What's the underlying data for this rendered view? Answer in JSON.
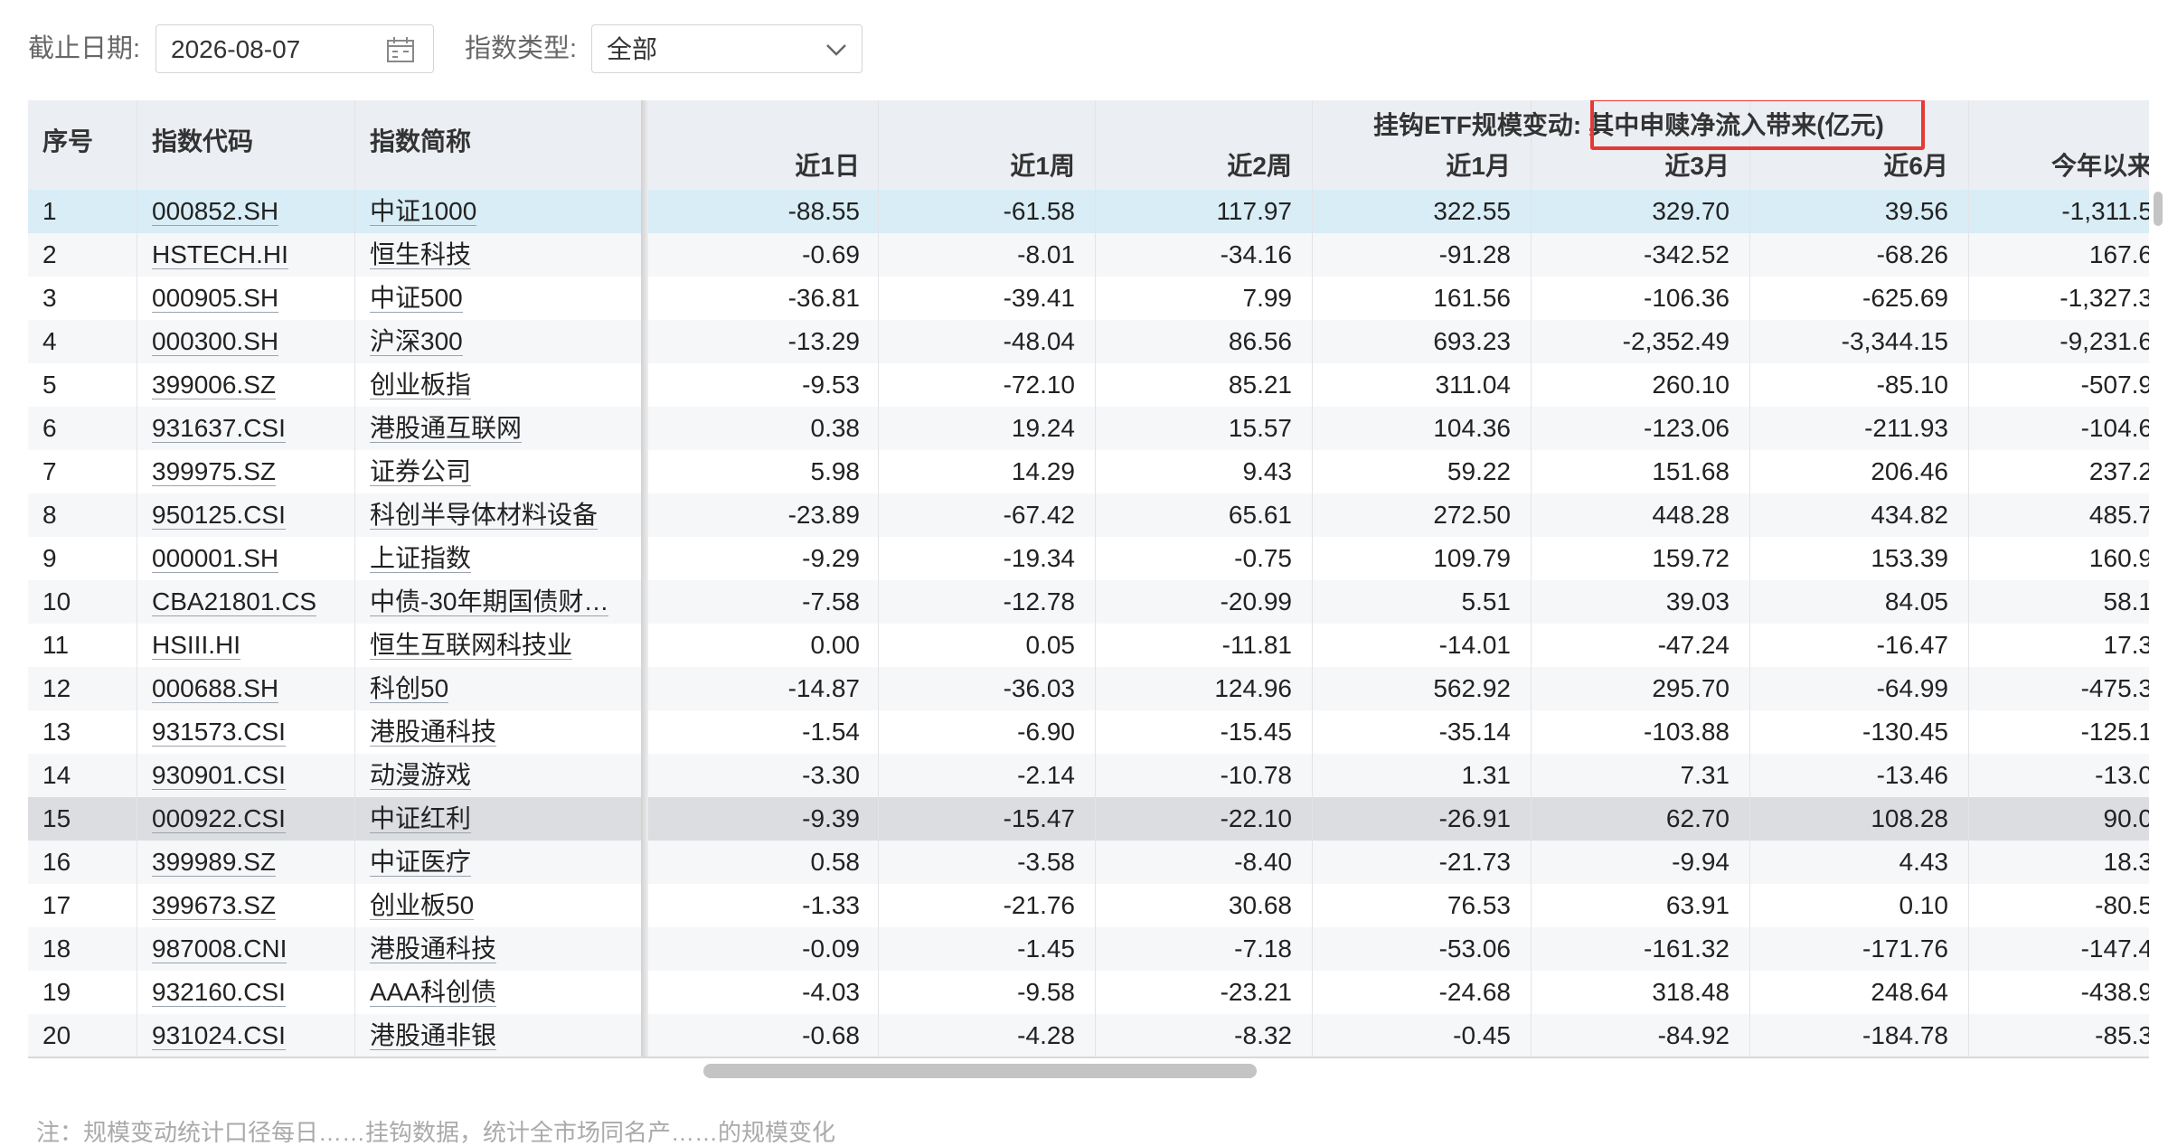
{
  "filters": {
    "date_label": "截止日期:",
    "date_value": "2026-08-07",
    "type_label": "指数类型:",
    "type_value": "全部"
  },
  "table": {
    "group_title": "挂钩ETF规模变动:",
    "group_subtitle": "其中申赎净流入带来(亿元)",
    "fixed_headers": [
      "序号",
      "指数代码",
      "指数简称"
    ],
    "period_headers": [
      "近1日",
      "近1周",
      "近2周",
      "近1月",
      "近3月",
      "近6月",
      "今年以来"
    ],
    "rows": [
      {
        "no": "1",
        "code": "000852.SH",
        "name": "中证1000",
        "v": [
          "-88.55",
          "-61.58",
          "117.97",
          "322.55",
          "329.70",
          "39.56",
          "-1,311.5"
        ]
      },
      {
        "no": "2",
        "code": "HSTECH.HI",
        "name": "恒生科技",
        "v": [
          "-0.69",
          "-8.01",
          "-34.16",
          "-91.28",
          "-342.52",
          "-68.26",
          "167.6"
        ]
      },
      {
        "no": "3",
        "code": "000905.SH",
        "name": "中证500",
        "v": [
          "-36.81",
          "-39.41",
          "7.99",
          "161.56",
          "-106.36",
          "-625.69",
          "-1,327.3"
        ]
      },
      {
        "no": "4",
        "code": "000300.SH",
        "name": "沪深300",
        "v": [
          "-13.29",
          "-48.04",
          "86.56",
          "693.23",
          "-2,352.49",
          "-3,344.15",
          "-9,231.6"
        ]
      },
      {
        "no": "5",
        "code": "399006.SZ",
        "name": "创业板指",
        "v": [
          "-9.53",
          "-72.10",
          "85.21",
          "311.04",
          "260.10",
          "-85.10",
          "-507.9"
        ]
      },
      {
        "no": "6",
        "code": "931637.CSI",
        "name": "港股通互联网",
        "v": [
          "0.38",
          "19.24",
          "15.57",
          "104.36",
          "-123.06",
          "-211.93",
          "-104.6"
        ]
      },
      {
        "no": "7",
        "code": "399975.SZ",
        "name": "证券公司",
        "v": [
          "5.98",
          "14.29",
          "9.43",
          "59.22",
          "151.68",
          "206.46",
          "237.2"
        ]
      },
      {
        "no": "8",
        "code": "950125.CSI",
        "name": "科创半导体材料设备",
        "v": [
          "-23.89",
          "-67.42",
          "65.61",
          "272.50",
          "448.28",
          "434.82",
          "485.7"
        ]
      },
      {
        "no": "9",
        "code": "000001.SH",
        "name": "上证指数",
        "v": [
          "-9.29",
          "-19.34",
          "-0.75",
          "109.79",
          "159.72",
          "153.39",
          "160.9"
        ]
      },
      {
        "no": "10",
        "code": "CBA21801.CS",
        "name": "中债-30年期国债财…",
        "v": [
          "-7.58",
          "-12.78",
          "-20.99",
          "5.51",
          "39.03",
          "84.05",
          "58.1"
        ]
      },
      {
        "no": "11",
        "code": "HSIII.HI",
        "name": "恒生互联网科技业",
        "v": [
          "0.00",
          "0.05",
          "-11.81",
          "-14.01",
          "-47.24",
          "-16.47",
          "17.3"
        ]
      },
      {
        "no": "12",
        "code": "000688.SH",
        "name": "科创50",
        "v": [
          "-14.87",
          "-36.03",
          "124.96",
          "562.92",
          "295.70",
          "-64.99",
          "-475.3"
        ]
      },
      {
        "no": "13",
        "code": "931573.CSI",
        "name": "港股通科技",
        "v": [
          "-1.54",
          "-6.90",
          "-15.45",
          "-35.14",
          "-103.88",
          "-130.45",
          "-125.1"
        ]
      },
      {
        "no": "14",
        "code": "930901.CSI",
        "name": "动漫游戏",
        "v": [
          "-3.30",
          "-2.14",
          "-10.78",
          "1.31",
          "7.31",
          "-13.46",
          "-13.0"
        ]
      },
      {
        "no": "15",
        "code": "000922.CSI",
        "name": "中证红利",
        "v": [
          "-9.39",
          "-15.47",
          "-22.10",
          "-26.91",
          "62.70",
          "108.28",
          "90.0"
        ]
      },
      {
        "no": "16",
        "code": "399989.SZ",
        "name": "中证医疗",
        "v": [
          "0.58",
          "-3.58",
          "-8.40",
          "-21.73",
          "-9.94",
          "4.43",
          "18.3"
        ]
      },
      {
        "no": "17",
        "code": "399673.SZ",
        "name": "创业板50",
        "v": [
          "-1.33",
          "-21.76",
          "30.68",
          "76.53",
          "63.91",
          "0.10",
          "-80.5"
        ]
      },
      {
        "no": "18",
        "code": "987008.CNI",
        "name": "港股通科技",
        "v": [
          "-0.09",
          "-1.45",
          "-7.18",
          "-53.06",
          "-161.32",
          "-171.76",
          "-147.4"
        ]
      },
      {
        "no": "19",
        "code": "932160.CSI",
        "name": "AAA科创债",
        "v": [
          "-4.03",
          "-9.58",
          "-23.21",
          "-24.68",
          "318.48",
          "248.64",
          "-438.9"
        ]
      },
      {
        "no": "20",
        "code": "931024.CSI",
        "name": "港股通非银",
        "v": [
          "-0.68",
          "-4.28",
          "-8.32",
          "-0.45",
          "-84.92",
          "-184.78",
          "-85.3"
        ]
      }
    ]
  },
  "colors": {
    "header_bg": "#ebeef3",
    "selected_row": "#d8edf5",
    "hover_row": "#dcdde1",
    "highlight_box": "#e53935"
  },
  "footnote": "注：规模变动统计口径每日……挂钩数据，统计全市场同名产……的规模变化"
}
